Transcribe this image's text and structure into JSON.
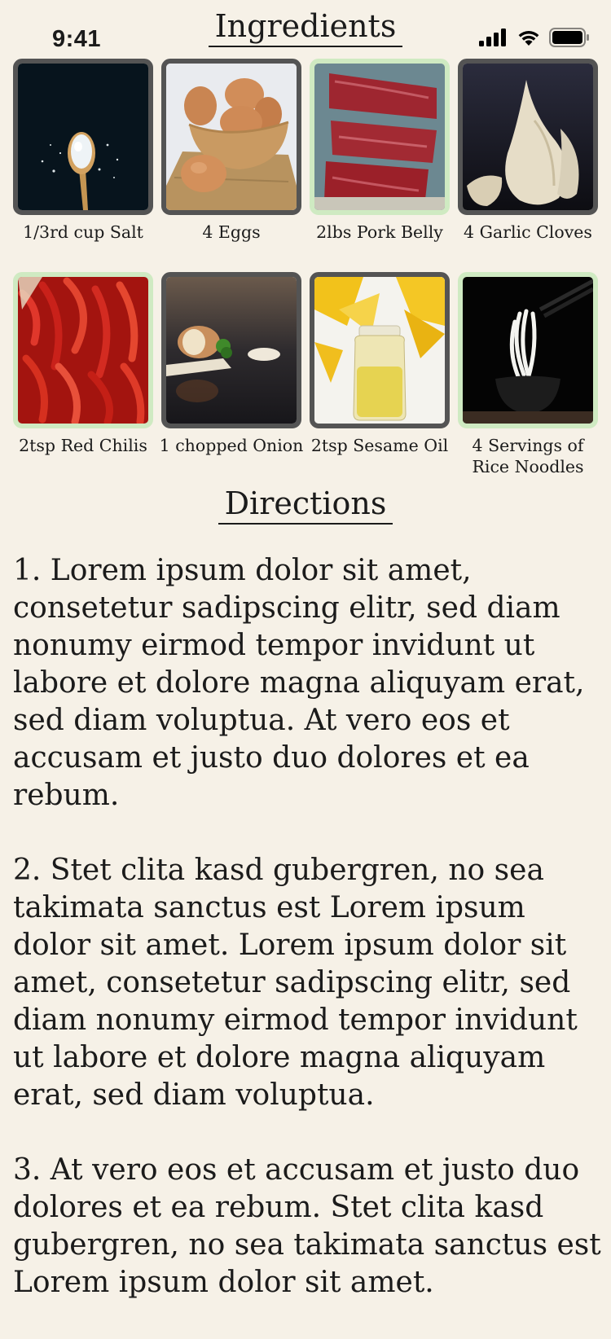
{
  "status_bar": {
    "time": "9:41",
    "icons": [
      "cellular-signal-icon",
      "wifi-icon",
      "battery-icon"
    ]
  },
  "ingredients": {
    "title": "Ingredients",
    "items": [
      {
        "label": "1/3rd cup Salt",
        "image": "salt-spoon-photo",
        "selected": false
      },
      {
        "label": "4 Eggs",
        "image": "eggs-bowl-photo",
        "selected": false
      },
      {
        "label": "2lbs Pork Belly",
        "image": "raw-meat-photo",
        "selected": true
      },
      {
        "label": "4 Garlic Cloves",
        "image": "garlic-photo",
        "selected": false
      },
      {
        "label": "2tsp Red Chilis",
        "image": "red-chilis-photo",
        "selected": true
      },
      {
        "label": "1 chopped Onion",
        "image": "onion-photo",
        "selected": false
      },
      {
        "label": "2tsp Sesame Oil",
        "image": "oil-jar-photo",
        "selected": false
      },
      {
        "label": "4 Servings of Rice Noodles",
        "image": "rice-noodles-photo",
        "selected": true
      }
    ]
  },
  "directions": {
    "title": "Directions",
    "steps": [
      "1. Lorem ipsum dolor sit amet, consetetur sadipscing elitr, sed diam nonumy eirmod tempor invidunt ut labore et dolore magna aliquyam erat, sed diam voluptua. At vero eos et accusam et justo duo dolores et ea rebum.",
      "2. Stet clita kasd gubergren, no sea takimata sanctus est Lorem ipsum dolor sit amet. Lorem ipsum dolor sit amet, consetetur sadipscing elitr, sed diam nonumy eirmod tempor invidunt ut labore et dolore magna aliquyam erat, sed diam voluptua.",
      "3. At vero eos et accusam et justo duo dolores et ea rebum. Stet clita kasd gubergren, no sea takimata sanctus est Lorem ipsum dolor sit amet."
    ]
  },
  "colors": {
    "background": "#f6f1e7",
    "card_border": "#545454",
    "card_border_selected": "#cfeac2",
    "text": "#1b1b1b"
  }
}
